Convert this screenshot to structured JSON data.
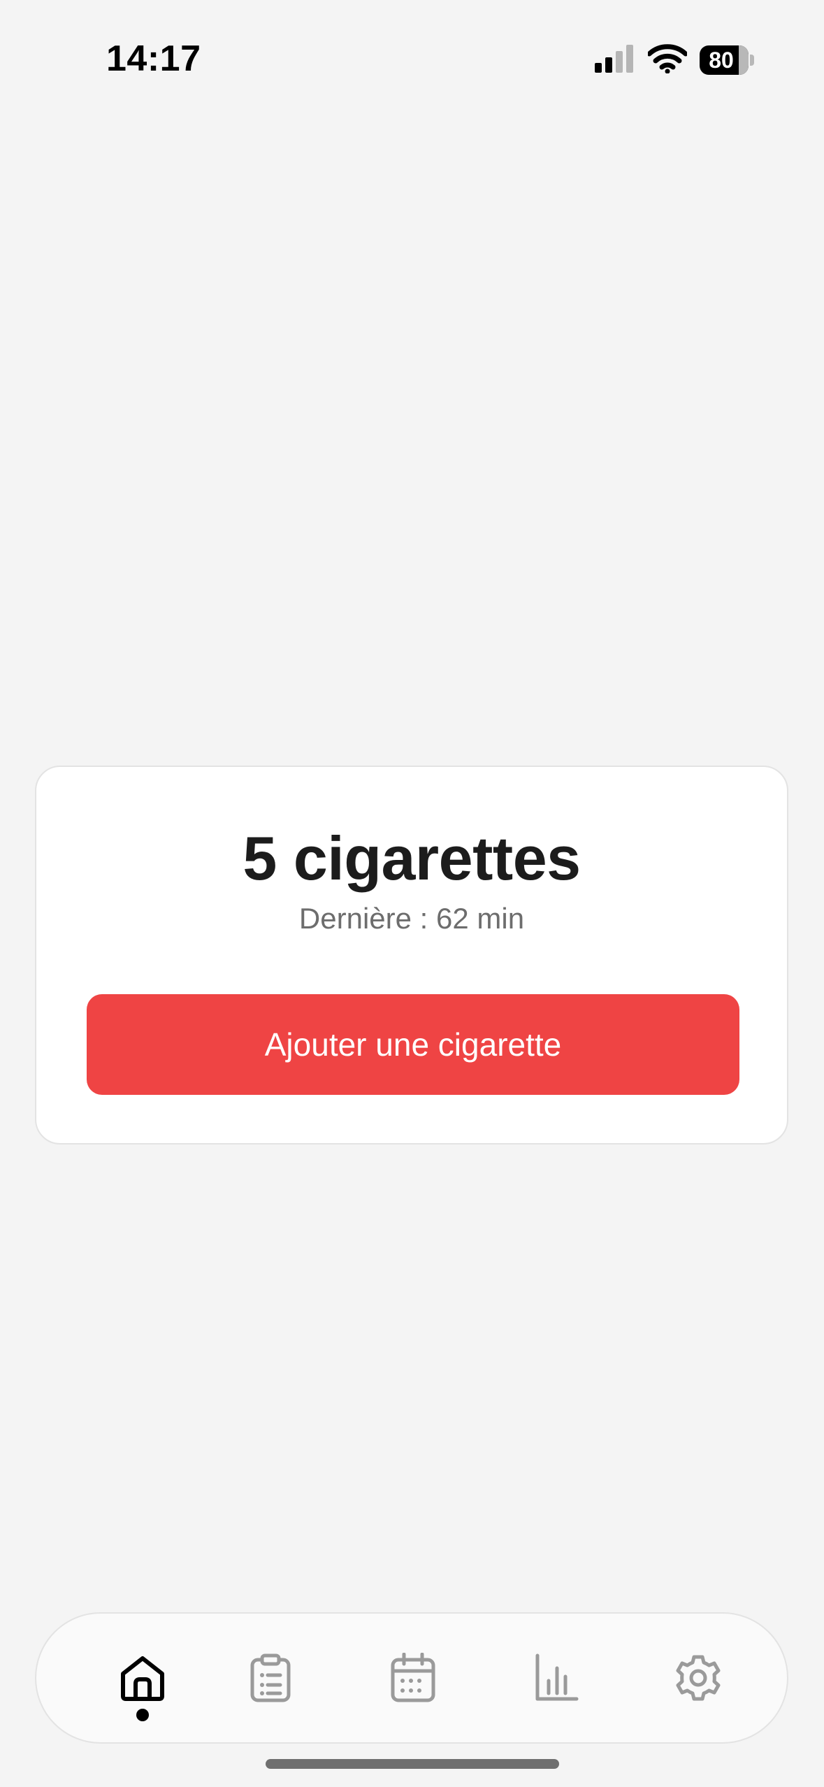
{
  "status_bar": {
    "time": "14:17",
    "battery_percent": "80",
    "signal_bars_active": 2,
    "signal_bars_total": 4
  },
  "card": {
    "count_title": "5 cigarettes",
    "last_label": "Dernière : 62 min",
    "add_button_label": "Ajouter une cigarette"
  },
  "tab_bar": {
    "tabs": [
      {
        "icon": "home-icon",
        "active": true
      },
      {
        "icon": "clipboard-list-icon",
        "active": false
      },
      {
        "icon": "calendar-icon",
        "active": false
      },
      {
        "icon": "bar-chart-icon",
        "active": false
      },
      {
        "icon": "gear-icon",
        "active": false
      }
    ]
  },
  "colors": {
    "background": "#f4f4f4",
    "accent_red": "#ef4444",
    "active_icon": "#000000",
    "inactive_icon": "#9a9a9a"
  }
}
